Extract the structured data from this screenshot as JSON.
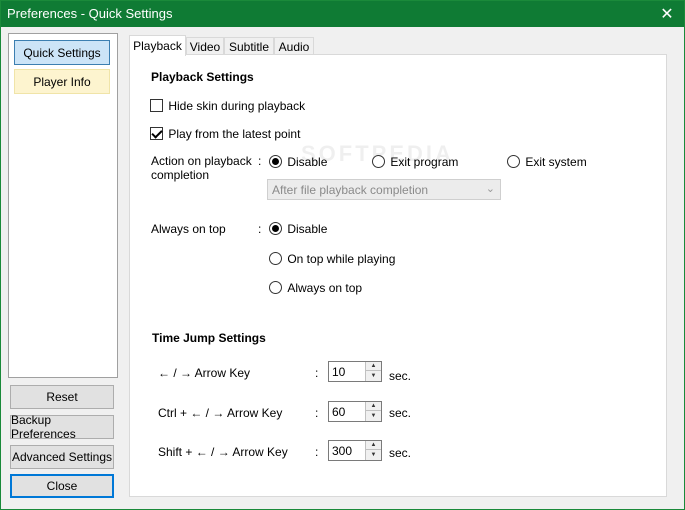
{
  "window": {
    "title": "Preferences - Quick Settings",
    "close_glyph": "✕"
  },
  "sidebar": {
    "items": [
      {
        "label": "Quick Settings"
      },
      {
        "label": "Player Info"
      }
    ]
  },
  "buttons": {
    "reset": "Reset",
    "backup": "Backup Preferences",
    "advanced": "Advanced Settings",
    "close": "Close"
  },
  "tabs": [
    {
      "label": "Playback"
    },
    {
      "label": "Video"
    },
    {
      "label": "Subtitle"
    },
    {
      "label": "Audio"
    }
  ],
  "playback": {
    "section_title": "Playback Settings",
    "hide_skin": {
      "label": "Hide skin during playback",
      "checked": false
    },
    "play_latest": {
      "label": "Play from the latest point",
      "checked": true
    },
    "action_label_1": "Action on playback",
    "action_label_2": "completion",
    "colon": ":",
    "action_options": [
      {
        "label": "Disable",
        "selected": true
      },
      {
        "label": "Exit program",
        "selected": false
      },
      {
        "label": "Exit system",
        "selected": false
      }
    ],
    "action_combo_value": "After file playback completion",
    "always_on_top_label": "Always on top",
    "on_top_options": [
      {
        "label": "Disable",
        "selected": true
      },
      {
        "label": "On top while playing",
        "selected": false
      },
      {
        "label": "Always on top",
        "selected": false
      }
    ]
  },
  "time_jump": {
    "section_title": "Time Jump Settings",
    "rows": [
      {
        "label": "← / → Arrow Key",
        "value": "10",
        "unit": "sec."
      },
      {
        "label": "Ctrl + ← / → Arrow Key",
        "value": "60",
        "unit": "sec."
      },
      {
        "label": "Shift + ← / → Arrow Key",
        "value": "300",
        "unit": "sec."
      }
    ]
  },
  "watermark": "SOFTPEDIA",
  "colors": {
    "titlebar": "#0f7b34",
    "selected_item": "#cce4f7",
    "info_item": "#fdf4cf",
    "focus": "#0078d7"
  },
  "icons": {
    "close": "close-icon",
    "spin_up": "spin-up-icon",
    "spin_down": "spin-down-icon",
    "combo": "chevron-down-icon"
  }
}
